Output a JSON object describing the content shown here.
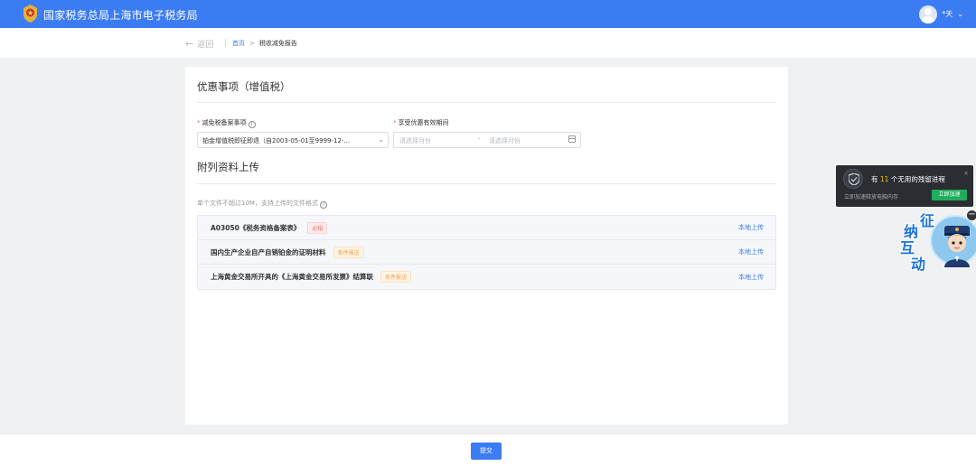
{
  "header": {
    "site_title": "国家税务总局上海市电子税务局",
    "username": "*天"
  },
  "breadcrumb": {
    "back_label": "返回",
    "home": "首页",
    "separator": ">",
    "current": "税收减免报告"
  },
  "form": {
    "section1_title": "优惠事项（增值税）",
    "field1_label": "减免税备案事项",
    "field1_value": "铂金增值税即征即退（自2003-05-01至9999-12-...",
    "field2_label": "享受优惠有效期间",
    "date_start_placeholder": "请选择月份",
    "date_range_sep": "-",
    "date_end_placeholder": "请选择月份",
    "section2_title": "附列资料上传",
    "upload_hint": "单个文件不超过10M，支持上传的文件格式",
    "files": [
      {
        "name": "A03050《税务资格备案表》",
        "tag": "必报",
        "tag_type": "required",
        "action": "本地上传"
      },
      {
        "name": "国内生产企业自产自销铂金的证明材料",
        "tag": "条件报送",
        "tag_type": "optional",
        "action": "本地上传"
      },
      {
        "name": "上海黄金交易所开具的《上海黄金交易所发票》结算联",
        "tag": "条件报送",
        "tag_type": "optional",
        "action": "本地上传"
      }
    ]
  },
  "footer": {
    "submit_label": "提交"
  },
  "popup": {
    "msg_prefix": "有",
    "count": "11",
    "msg_suffix": "个无用的残留进程",
    "sub": "立即加速释放电脑内存",
    "button": "立即加速",
    "close": "×"
  },
  "mascot": {
    "chars": [
      "征",
      "纳",
      "互",
      "动"
    ],
    "minimize": "−"
  },
  "colors": {
    "primary": "#3c7cf3",
    "required_tag": "#f56c6c",
    "optional_tag": "#f0a043",
    "accelerate": "#1fae5b"
  }
}
